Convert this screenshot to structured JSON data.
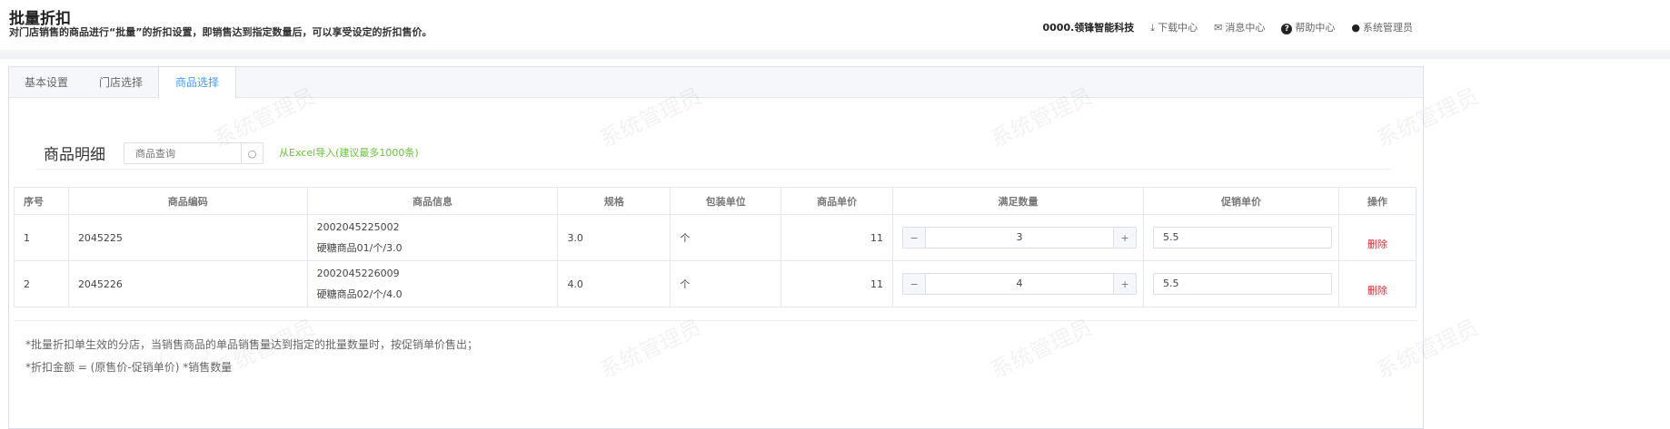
{
  "header": {
    "title": "批量折扣",
    "subtitle": "对门店销售的商品进行“批量”的折扣设置，即销售达到指定数量后，可以享受设定的折扣售价。",
    "org": "0000.领锋智能科技",
    "download": "下载中心",
    "messages": "消息中心",
    "help": "帮助中心",
    "user": "系统管理员"
  },
  "tabs": [
    "基本设置",
    "门店选择",
    "商品选择"
  ],
  "section": {
    "title": "商品明细",
    "search_placeholder": "商品查询",
    "import_link": "从Excel导入(建议最多1000条)"
  },
  "table": {
    "headers": [
      "序号",
      "商品编码",
      "商品信息",
      "规格",
      "包装单位",
      "商品单价",
      "满足数量",
      "促销单价",
      "操作"
    ],
    "rows": [
      {
        "no": "1",
        "code": "2045225",
        "barcode": "2002045225002",
        "name": "硬糖商品01/个/3.0",
        "spec": "3.0",
        "unit": "个",
        "price": "11",
        "qty": "3",
        "promo": "5.5",
        "action": "删除"
      },
      {
        "no": "2",
        "code": "2045226",
        "barcode": "2002045226009",
        "name": "硬糖商品02/个/4.0",
        "spec": "4.0",
        "unit": "个",
        "price": "11",
        "qty": "4",
        "promo": "5.5",
        "action": "删除"
      }
    ]
  },
  "notes": [
    "*批量折扣单生效的分店，当销售商品的单品销售量达到指定的批量数量时，按促销单价售出；",
    "*折扣金额 = (原售价-促销单价) *销售数量"
  ],
  "watermark": "系统管理员"
}
